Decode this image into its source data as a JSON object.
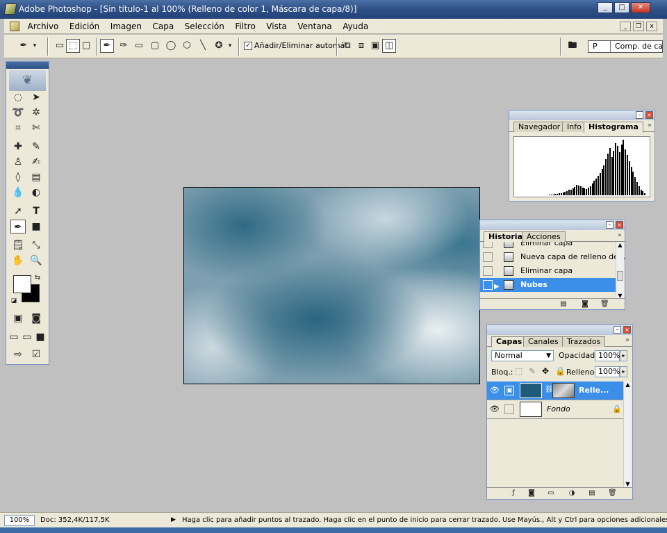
{
  "window": {
    "title": "Adobe Photoshop - [Sin título-1 al 100% (Relleno de color 1, Máscara de capa/8)]",
    "minimize": "_",
    "maximize": "□",
    "close": "✕"
  },
  "menu": {
    "items": [
      "Archivo",
      "Edición",
      "Imagen",
      "Capa",
      "Selección",
      "Filtro",
      "Vista",
      "Ventana",
      "Ayuda"
    ],
    "min": "_",
    "restore": "❐",
    "close": "x"
  },
  "options": {
    "auto_add_label": "Añadir/Eliminar automát.",
    "auto_add_checked": "✓",
    "palette_well_label": "Comp. de cap",
    "palette_well_tab": "P"
  },
  "navigator_panel": {
    "tabs": [
      "Navegador",
      "Info",
      "Histograma"
    ],
    "active_tab": "Histograma",
    "histogram": [
      1,
      1,
      1,
      2,
      2,
      3,
      3,
      4,
      5,
      6,
      8,
      9,
      11,
      13,
      16,
      15,
      14,
      12,
      11,
      10,
      12,
      14,
      18,
      22,
      26,
      30,
      34,
      40,
      46,
      55,
      64,
      72,
      58,
      68,
      80,
      75,
      66,
      78,
      85,
      70,
      62,
      52,
      44,
      36,
      28,
      20,
      14,
      9,
      6,
      3
    ]
  },
  "history_panel": {
    "tabs": [
      "Historia",
      "Acciones"
    ],
    "items": [
      "Eliminar capa",
      "Nueva capa de relleno de ...",
      "Eliminar capa",
      "Nubes"
    ],
    "selected": "Nubes"
  },
  "layers_panel": {
    "tabs": [
      "Capas",
      "Canales",
      "Trazados"
    ],
    "blend_mode": "Normal",
    "opacity_label": "Opacidad:",
    "opacity": "100%",
    "lock_label": "Bloq.:",
    "fill_label": "Relleno:",
    "fill": "100%",
    "layers": [
      {
        "name": "Relle...",
        "selected": true
      },
      {
        "name": "Fondo",
        "selected": false
      }
    ]
  },
  "status": {
    "zoom": "100%",
    "doc": "Doc: 352,4K/117,5K",
    "hint": "Haga clic para añadir puntos al trazado. Haga clic en el punto de inicio para cerrar trazado. Use Mayús., Alt y Ctrl para opciones adicionales."
  },
  "colors": {
    "title_bar": "#2d4f86",
    "selection": "#3b8fe8",
    "canvas_dark": "#2f6a84",
    "canvas_light": "#e9eff2"
  }
}
